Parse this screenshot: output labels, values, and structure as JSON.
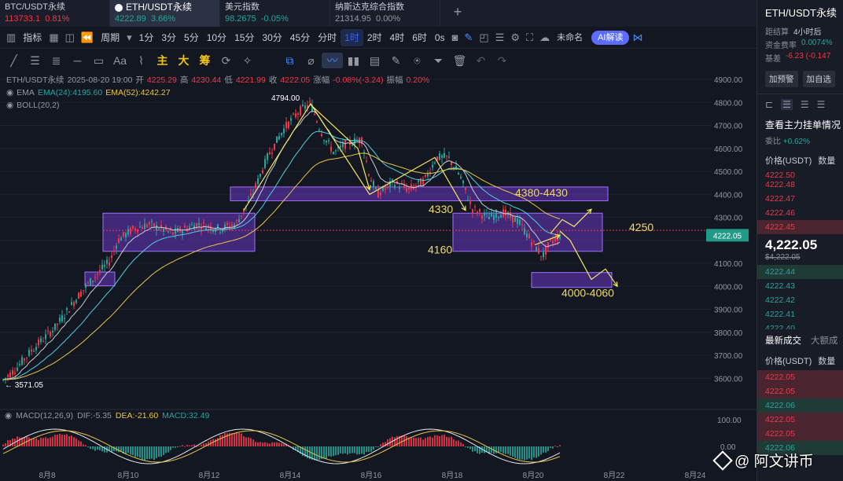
{
  "tabs": [
    {
      "name": "BTC/USDT永续",
      "price": "113733.1",
      "change": "0.81%",
      "tone": "red",
      "active": false
    },
    {
      "name": "ETH/USDT永续",
      "price": "4222.89",
      "change": "3.66%",
      "tone": "green",
      "active": true
    },
    {
      "name": "美元指数",
      "price": "98.2675",
      "change": "-0.05%",
      "tone": "green",
      "active": false
    },
    {
      "name": "纳斯达克综合指数",
      "price": "21314.95",
      "change": "0.00%",
      "tone": "grey",
      "active": false
    }
  ],
  "toolbar": {
    "indicator": "指标",
    "period": "周期",
    "timeframes": [
      "1分",
      "3分",
      "5分",
      "10分",
      "15分",
      "30分",
      "45分",
      "分时",
      "1时",
      "2时",
      "4时",
      "6时",
      "0s"
    ],
    "active_timeframe": "1时",
    "layout_name": "未命名",
    "ai_label": "AI解读"
  },
  "drawing_tools": {
    "text_tool": "Aa",
    "main": "主",
    "big": "大",
    "chip": "筹"
  },
  "legend": {
    "symbol": "ETH/USDT永续",
    "datetime": "2025-08-20 19:00",
    "open_label": "开",
    "open": "4225.29",
    "high_label": "高",
    "high": "4230.44",
    "low_label": "低",
    "low": "4221.99",
    "close_label": "收",
    "close": "4222.05",
    "change_label": "涨幅",
    "change": "-0.08%(-3.24)",
    "amp_label": "振幅",
    "amp": "0.20%",
    "ema_label": "EMA",
    "ema24": "EMA(24):4195.60",
    "ema52": "EMA(52):4242.27",
    "boll": "BOLL(20,2)"
  },
  "macd_legend": {
    "name": "MACD(12,26,9)",
    "dif": "DIF:-5.35",
    "dea": "DEA:-21.60",
    "macd": "MACD:32.49"
  },
  "annotations": {
    "high": "4794.00",
    "low": "3571.05",
    "zone_top": "4380-4430",
    "level_4330": "4330",
    "level_4250": "4250",
    "level_4160": "4160",
    "zone_bottom": "4000-4060"
  },
  "price_axis": {
    "ticks": [
      "4900.00",
      "4800.00",
      "4700.00",
      "4600.00",
      "4500.00",
      "4400.00",
      "4300.00",
      "4100.00",
      "4000.00",
      "3900.00",
      "3800.00",
      "3700.00",
      "3600.00"
    ],
    "current": "4222.05",
    "macd_ticks": [
      "100.00",
      "0.00"
    ]
  },
  "date_axis": [
    "8月8",
    "8月10",
    "8月12",
    "8月14",
    "8月16",
    "8月18",
    "8月20",
    "8月22",
    "8月24"
  ],
  "colors": {
    "up": "#26a69a",
    "down": "#f23645",
    "zone": "#7b3fe4",
    "ema24": "#4dd0e1",
    "ema52": "#e8c547",
    "arrow": "#f5e663"
  },
  "panel": {
    "title": "ETH/USDT永续",
    "rows": [
      {
        "label": "距结算",
        "value": "4小时后",
        "tone": ""
      },
      {
        "label": "资金费率",
        "value": "0.0074%",
        "tone": "teal"
      },
      {
        "label": "基差",
        "value": "-6.23 (-0.147",
        "tone": "red"
      }
    ],
    "alert_btn": "加预警",
    "watch_btn": "加自选",
    "orderbook_section": "查看主力挂单情况",
    "ratio_label": "委比",
    "ratio_value": "+0.62%",
    "head_price": "价格(USDT)",
    "head_qty": "数量",
    "asks": [
      "4222.50",
      "4222.48",
      "4222.47",
      "4222.46",
      "4222.45"
    ],
    "last": "4,222.05",
    "last_sub": "$4,222.05",
    "bids": [
      "4222.44",
      "4222.43",
      "4222.42",
      "4222.41",
      "4222.40"
    ],
    "trades_tab": "最新成交",
    "bigorder_tab": "大额成",
    "trades": [
      {
        "price": "4222.05",
        "side": "ask"
      },
      {
        "price": "4222.05",
        "side": "ask"
      },
      {
        "price": "4222.06",
        "side": "bid"
      },
      {
        "price": "4222.05",
        "side": "ask"
      },
      {
        "price": "4222.05",
        "side": "ask"
      },
      {
        "price": "4222.06",
        "side": "bid"
      }
    ]
  },
  "watermark": "@ 阿文讲币"
}
